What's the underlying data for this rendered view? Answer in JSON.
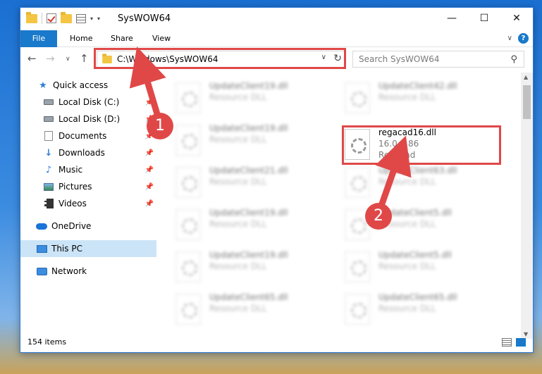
{
  "titlebar": {
    "title": "SysWOW64",
    "minimize": "—",
    "maximize": "☐",
    "close": "✕"
  },
  "ribbon": {
    "tabs": [
      "File",
      "Home",
      "Share",
      "View"
    ],
    "expand": "∨",
    "help": "?"
  },
  "nav": {
    "back": "←",
    "forward": "→",
    "recent": "∨",
    "up": "↑",
    "address": "C:\\Windows\\SysWOW64",
    "address_dropdown": "∨",
    "refresh": "↻",
    "search_placeholder": "Search SysWOW64",
    "search_icon": "⚲"
  },
  "sidebar": {
    "items": [
      {
        "label": "Quick access",
        "icon": "star-icon",
        "pinned": false
      },
      {
        "label": "Local Disk (C:)",
        "icon": "disk-icon",
        "pinned": true
      },
      {
        "label": "Local Disk (D:)",
        "icon": "disk-icon",
        "pinned": true
      },
      {
        "label": "Documents",
        "icon": "documents-icon",
        "pinned": true
      },
      {
        "label": "Downloads",
        "icon": "downloads-icon",
        "pinned": true
      },
      {
        "label": "Music",
        "icon": "music-icon",
        "pinned": true
      },
      {
        "label": "Pictures",
        "icon": "pictures-icon",
        "pinned": true
      },
      {
        "label": "Videos",
        "icon": "videos-icon",
        "pinned": true
      },
      {
        "label": "OneDrive",
        "icon": "onedrive-icon",
        "pinned": false
      },
      {
        "label": "This PC",
        "icon": "pc-icon",
        "pinned": false,
        "selected": true
      },
      {
        "label": "Network",
        "icon": "network-icon",
        "pinned": false
      }
    ]
  },
  "files": {
    "left": [
      {
        "name": "UpdateClient19.dll",
        "type": "Resource DLL"
      },
      {
        "name": "UpdateClient19.dll",
        "type": "Resource DLL"
      },
      {
        "name": "UpdateClient21.dll",
        "type": "Resource DLL"
      },
      {
        "name": "UpdateClient19.dll",
        "type": "Resource DLL"
      },
      {
        "name": "UpdateClient19.dll",
        "type": "Resource DLL"
      },
      {
        "name": "UpdateClient65.dll",
        "type": "Resource DLL"
      }
    ],
    "right": [
      {
        "name": "UpdateClient42.dll",
        "type": "Resource DLL"
      },
      {
        "name": "UpdateClient63.dll",
        "type": "Resource DLL"
      },
      {
        "name": "UpdateClient5.dll",
        "type": "Resource DLL"
      },
      {
        "name": "UpdateClient5.dll",
        "type": "Resource DLL"
      },
      {
        "name": "UpdateClient65.dll",
        "type": "Resource DLL"
      }
    ],
    "highlighted": {
      "name": "regacad16.dll",
      "version": "16.0.0.86",
      "company": "RegAcad"
    }
  },
  "status": {
    "count": "154 items"
  },
  "annotations": {
    "step1": "1",
    "step2": "2"
  },
  "colors": {
    "accent": "#1979ca",
    "highlight": "#e04848",
    "selected_bg": "#cce4f7"
  }
}
